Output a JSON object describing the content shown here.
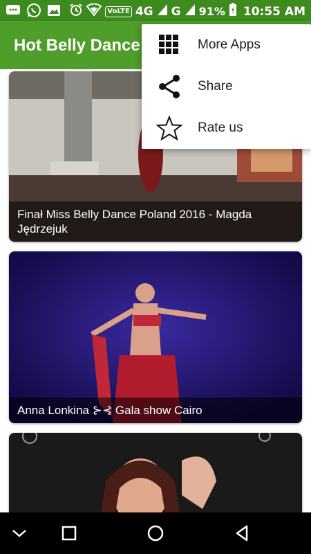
{
  "status_bar": {
    "network": "4G",
    "volte_label": "VoLTE",
    "network2": "G",
    "battery_percent": "91%",
    "time": "10:55 AM",
    "left_icons": [
      "chat-icon",
      "whatsapp-icon",
      "image-icon"
    ],
    "right_icons": [
      "alarm-icon",
      "hotspot-icon",
      "signal-icon",
      "battery-icon"
    ]
  },
  "app_bar": {
    "title": "Hot Belly Dance",
    "color": "#4f9d2a"
  },
  "menu": {
    "items": [
      {
        "label": "More Apps",
        "icon": "grid-icon"
      },
      {
        "label": "Share",
        "icon": "share-icon"
      },
      {
        "label": "Rate us",
        "icon": "star-icon"
      }
    ]
  },
  "videos": [
    {
      "title": "Finał Miss Belly Dance Poland 2016 - Magda Jędrzejuk"
    },
    {
      "title": "Anna Lonkina ⊱⊰ Gala show Cairo"
    },
    {
      "title": ""
    }
  ],
  "nav_bar": {
    "buttons": [
      "collapse-icon",
      "recents-icon",
      "home-icon",
      "back-icon"
    ]
  }
}
